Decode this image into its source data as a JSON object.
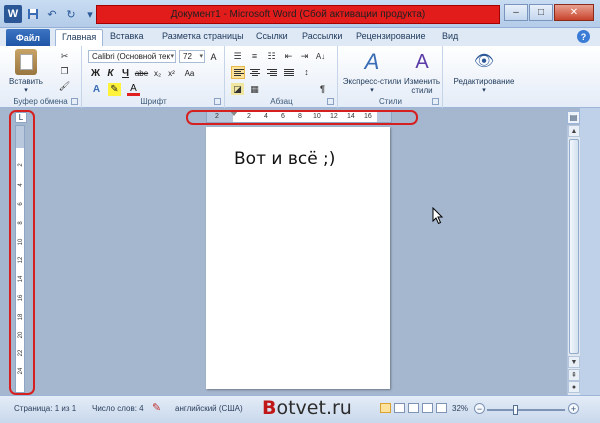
{
  "window": {
    "title": "Документ1  -  Microsoft Word (Сбой активации продукта)",
    "app_icon": "W",
    "min": "–",
    "max": "□",
    "close": "✕"
  },
  "qat": {
    "save_icon": "💾",
    "undo_icon": "↶",
    "redo_icon": "↻",
    "customize_icon": "▾"
  },
  "tabs": {
    "file": "Файл",
    "items": [
      "Главная",
      "Вставка",
      "Разметка страницы",
      "Ссылки",
      "Рассылки",
      "Рецензирование",
      "Вид"
    ],
    "help": "?"
  },
  "ribbon": {
    "clipboard": {
      "label": "Буфер обмена",
      "paste": "Вставить"
    },
    "font": {
      "label": "Шрифт",
      "name": "Calibri (Основной тек",
      "size": "72",
      "bold": "Ж",
      "italic": "К",
      "underline": "Ч",
      "strike": "abe",
      "sub": "x₂",
      "sup": "x²",
      "aa": "Aa",
      "grow": "A",
      "shrink": "A",
      "color": "A"
    },
    "paragraph": {
      "label": "Абзац",
      "pilcrow": "¶",
      "sort": "A↓"
    },
    "styles": {
      "label": "Стили",
      "quick": "Экспресс-стили",
      "change": "Изменить стили"
    },
    "editing": {
      "label": "Редактирование"
    }
  },
  "ruler": {
    "corner": "L",
    "h_ticks": [
      "2",
      "2",
      "4",
      "6",
      "8",
      "10",
      "12",
      "14",
      "16"
    ],
    "v_ticks": [
      "2",
      "4",
      "6",
      "8",
      "10",
      "12",
      "14",
      "16",
      "18",
      "20",
      "22",
      "24"
    ]
  },
  "document": {
    "text": "Вот и всё ;)"
  },
  "status": {
    "page": "Страница: 1 из 1",
    "words": "Число слов: 4",
    "language": "английский (США)",
    "zoom": "32%",
    "zoom_minus": "−",
    "zoom_plus": "+"
  },
  "watermark": {
    "b": "B",
    "rest": "otvet.ru"
  },
  "colors": {
    "accent": "#2b5797",
    "highlight": "#d62020",
    "active_button": "#fce29a"
  }
}
